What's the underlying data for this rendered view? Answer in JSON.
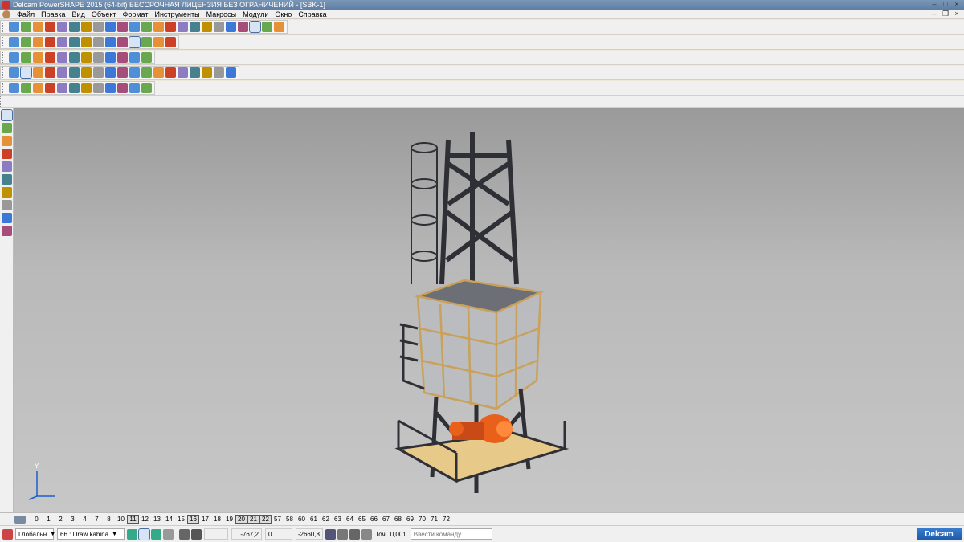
{
  "window": {
    "title": "Delcam PowerSHAPE 2015 (64-bit) БЕССРОЧНАЯ ЛИЦЕНЗИЯ БЕЗ ОГРАНИЧЕНИЙ - [SBK-1]",
    "controls": [
      "–",
      "□",
      "×"
    ]
  },
  "menu": [
    "Файл",
    "Правка",
    "Вид",
    "Объект",
    "Формат",
    "Инструменты",
    "Макросы",
    "Модули",
    "Окно",
    "Справка"
  ],
  "mdi_controls": [
    "–",
    "❐",
    "×"
  ],
  "toolbars": {
    "row1_icons": [
      "new-file-icon",
      "open-icon",
      "open-model-icon",
      "save-icon",
      "print-icon",
      "cut-icon",
      "copy-icon",
      "paste-icon",
      "delete-icon",
      "select-all-icon",
      "undo-icon",
      "redo-icon",
      "repeat-icon",
      "view-icon",
      "arrow-icon",
      "polyline-icon",
      "circle-icon",
      "curve-icon",
      "text-icon",
      "surface-icon",
      "solid-icon",
      "mesh-icon",
      "magic-icon"
    ],
    "row2_icons": [
      "view-front-icon",
      "view-top-icon",
      "view-side-icon",
      "iso-icon",
      "rotate-icon",
      "zoom-icon",
      "zoom-all-icon",
      "zoom-box-icon",
      "zoom-sel-icon",
      "sphere-icon",
      "shade-icon",
      "render-icon",
      "lamp-icon",
      "hand-icon"
    ],
    "row3_icons": [
      "shaded-icon",
      "wire-icon",
      "doc-icon",
      "cube-icon",
      "sphere-icon",
      "red-sphere-icon",
      "cone-icon",
      "torus-icon",
      "box-icon",
      "block-icon",
      "feature-icon",
      "move-icon"
    ],
    "row4_icons": [
      "solid-a-icon",
      "solid-b-icon",
      "boolean-icon",
      "boolean2-icon",
      "fillet-icon",
      "chamfer-icon",
      "shell-icon",
      "draft-icon",
      "cut-icon",
      "extrude-icon",
      "revolve-icon",
      "sweep-icon",
      "loft-icon",
      "blend-icon",
      "offset-icon",
      "mirror-icon",
      "array-icon",
      "pattern-icon",
      "split-icon"
    ],
    "row5_icons": [
      "cursor-icon",
      "point-icon",
      "line-icon",
      "arc-icon",
      "solid-icon",
      "solid-feat-icon",
      "boss-icon",
      "pocket-icon",
      "hole-icon",
      "pipe-icon",
      "rib-icon",
      "face-icon"
    ],
    "left_icons": [
      "select-icon",
      "multi-select-icon",
      "line-tool-icon",
      "arc-tool-icon",
      "curve-tool-icon",
      "surface-tool-icon",
      "solid-tool-icon",
      "dimension-tool-icon",
      "annotation-tool-icon",
      "mesh-tool-icon"
    ]
  },
  "levels": {
    "items": [
      "0",
      "1",
      "2",
      "3",
      "4",
      "7",
      "8",
      "10",
      "11",
      "12",
      "13",
      "14",
      "15",
      "16",
      "17",
      "18",
      "19",
      "20",
      "21",
      "22",
      "57",
      "58",
      "60",
      "61",
      "62",
      "63",
      "64",
      "65",
      "66",
      "67",
      "68",
      "69",
      "70",
      "71",
      "72"
    ],
    "active": [
      "11",
      "16",
      "20",
      "21",
      "22"
    ]
  },
  "status": {
    "workplane": "Глобальн",
    "level_num": "66",
    "level_name": ": Draw kabina",
    "x": "-767,2",
    "y": "0",
    "z": "-2660,8",
    "tol_label": "Точ",
    "tol_value": "0,001",
    "command_placeholder": "Ввести команду",
    "brand": "Delcam"
  },
  "axis": {
    "y": "Y"
  },
  "colors": {
    "titlebar": "#5f7ea3",
    "viewport_top": "#9a9a9a",
    "viewport_bottom": "#c7c7c7",
    "steel": "#2f3036",
    "glass_frame": "#c9a15a",
    "motor": "#e8601a",
    "platform": "#e7c98a"
  }
}
